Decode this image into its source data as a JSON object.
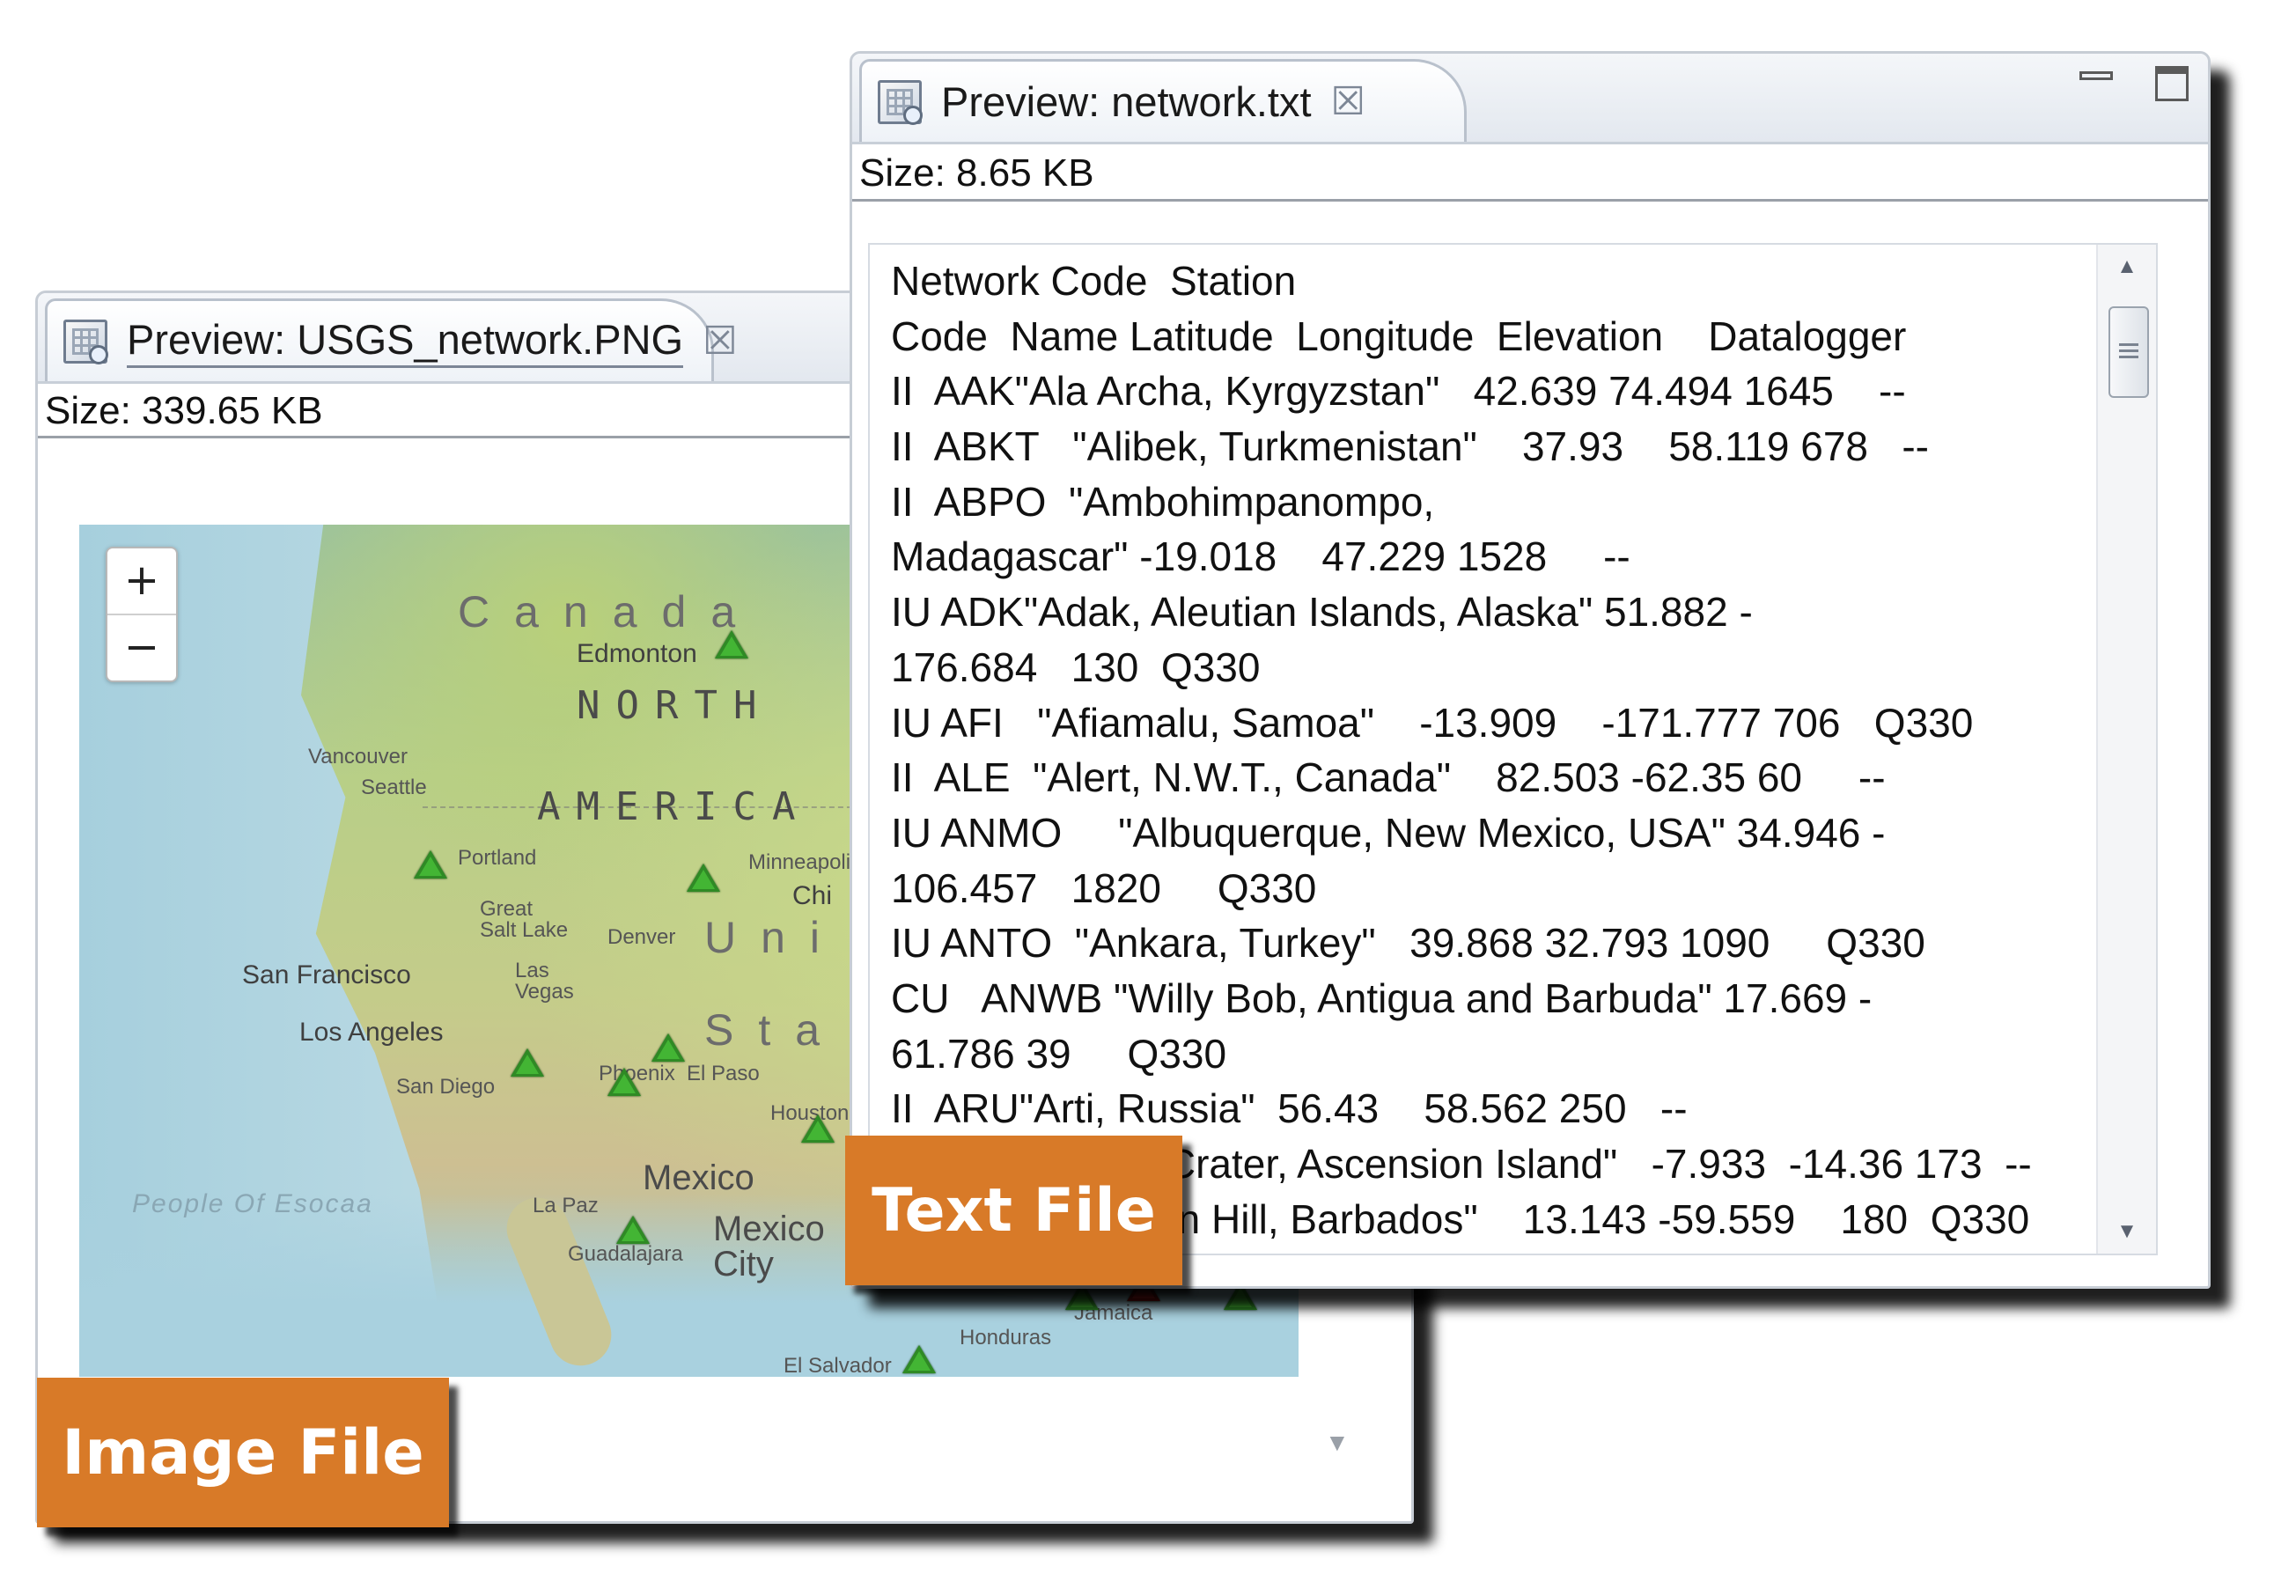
{
  "image_window": {
    "tab_title": "Preview: USGS_network.PNG",
    "close_glyph": "☒",
    "size_label": "Size: 339.65 KB",
    "map": {
      "zoom_in": "+",
      "zoom_out": "−",
      "labels": {
        "canada": "Canada",
        "north": "NORTH",
        "america": "AMERICA",
        "united": "Uni",
        "states": "Sta",
        "edmonton": "Edmonton",
        "vancouver": "Vancouver",
        "seattle": "Seattle",
        "portland": "Portland",
        "minneapolis": "Minneapolis",
        "chicago": "Chi",
        "great_salt_lake": "Great\nSalt Lake",
        "denver": "Denver",
        "las_vegas": "Las\nVegas",
        "san_francisco": "San Francisco",
        "los_angeles": "Los Angeles",
        "san_diego": "San Diego",
        "phoenix": "Phoenix",
        "el_paso": "El Paso",
        "houston": "Houston",
        "mexico_country": "Mexico",
        "mexico_city": "Mexico\nCity",
        "la_paz": "La Paz",
        "guadalajara": "Guadalajara",
        "honduras": "Honduras",
        "el_salvador": "El Salvador",
        "jamaica": "Jamaica",
        "watermark": "People Of Esocaa"
      }
    }
  },
  "text_window": {
    "tab_title": "Preview: network.txt",
    "close_glyph": "☒",
    "size_label": "Size: 8.65 KB",
    "lines": [
      "Network Code  Station",
      "Code  Name Latitude  Longitude  Elevation    Datalogger",
      "II  AAK\"Ala Archa, Kyrgyzstan\"   42.639 74.494 1645    --",
      "II  ABKT   \"Alibek, Turkmenistan\"    37.93    58.119 678   --",
      "II  ABPO  \"Ambohimpanompo,",
      "Madagascar\" -19.018    47.229 1528     --",
      "IU ADK\"Adak, Aleutian Islands, Alaska\" 51.882 -",
      "176.684   130  Q330",
      "IU AFI   \"Afiamalu, Samoa\"    -13.909    -171.777 706   Q330",
      "II  ALE  \"Alert, N.W.T., Canada\"    82.503 -62.35 60     --",
      "IU ANMO     \"Albuquerque, New Mexico, USA\" 34.946 -",
      "106.457   1820     Q330",
      "IU ANTO  \"Ankara, Turkey\"   39.868 32.793 1090     Q330",
      "CU   ANWB \"Willy Bob, Antigua and Barbuda\" 17.669 -",
      "61.786 39     Q330",
      "II  ARU\"Arti, Russia\"  56.43    58.562 250   --",
      "II  ASCN  \"Butt Crater, Ascension Island\"   -7.933  -14.36 173  --",
      "CU  BBGH  \"Gun Hill, Barbados\"    13.143 -59.559    180  Q330"
    ],
    "scroll_up": "▲",
    "scroll_down": "▼"
  },
  "callouts": {
    "text_file": "Text File",
    "image_file": "Image File"
  },
  "colors": {
    "callout": "#d87a28",
    "station_green": "#43b534",
    "station_red": "#d22a2a"
  }
}
